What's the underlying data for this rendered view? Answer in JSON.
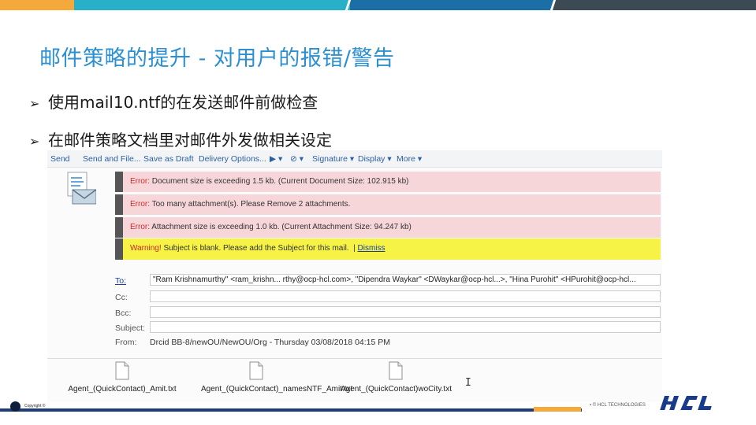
{
  "title": "邮件策略的提升 - 对用户的报错/警告",
  "bullets": [
    {
      "arrow": "➢",
      "text": "使用mail10.ntf的在发送邮件前做检查"
    },
    {
      "arrow": "➢",
      "text": "在邮件策略文档里对邮件外发做相关设定"
    }
  ],
  "mail": {
    "toolbar": {
      "send": "Send",
      "send_and_file": "Send and File...",
      "save_as_draft": "Save as Draft",
      "delivery_options": "Delivery Options...",
      "flag": "▶ ▾",
      "attach": "⊘ ▾",
      "signature": "Signature ▾",
      "display": "Display ▾",
      "more": "More ▾"
    },
    "messages": [
      {
        "type": "error",
        "prefix": "Error:",
        "text": "Document size is exceeding 1.5 kb. (Current Document Size: 102.915 kb)"
      },
      {
        "type": "error",
        "prefix": "Error:",
        "text": "Too many attachment(s). Please Remove 2 attachments."
      },
      {
        "type": "error",
        "prefix": "Error:",
        "text": "Attachment size is exceeding 1.0 kb. (Current Attachment Size: 94.247 kb)"
      },
      {
        "type": "warning",
        "prefix": "Warning!",
        "text": "Subject is blank. Please add the Subject for this mail.",
        "sep": "|",
        "dismiss": "Dismiss"
      }
    ],
    "fields": {
      "to_label": "To:",
      "to_value": "\"Ram Krishnamurthy\" <ram_krishn... rthy@ocp-hcl.com>, \"Dipendra Waykar\" <DWaykar@ocp-hcl...>, \"Hina Purohit\" <HPurohit@ocp-hcl...",
      "cc_label": "Cc:",
      "bcc_label": "Bcc:",
      "subject_label": "Subject:",
      "from_label": "From:",
      "from_value": "Drcid BB-8/newOU/NewOU/Org - Thursday 03/08/2018 04:15 PM"
    },
    "attachments": [
      "Agent_(QuickContact)_Amit.txt",
      "Agent_(QuickContact)_namesNTF_Amit.txt",
      "Agent_(QuickContact)woCity.txt"
    ],
    "cursor_glyph": "I"
  },
  "footer": {
    "copyright": "Copyright ©",
    "right_text": "▪ © HCL TECHNOLOGIES",
    "logo_text": "HCL"
  },
  "colors": {
    "title": "#2b8fd1",
    "error_bg": "#f7d6da",
    "warning_bg": "#f6f246",
    "error_text": "#d02a2a",
    "link": "#1a3fa0",
    "logo": "#1a3a8c"
  },
  "icons": {
    "mail_compose": "envelope-document-icon",
    "attachment": "text-file-icon"
  }
}
